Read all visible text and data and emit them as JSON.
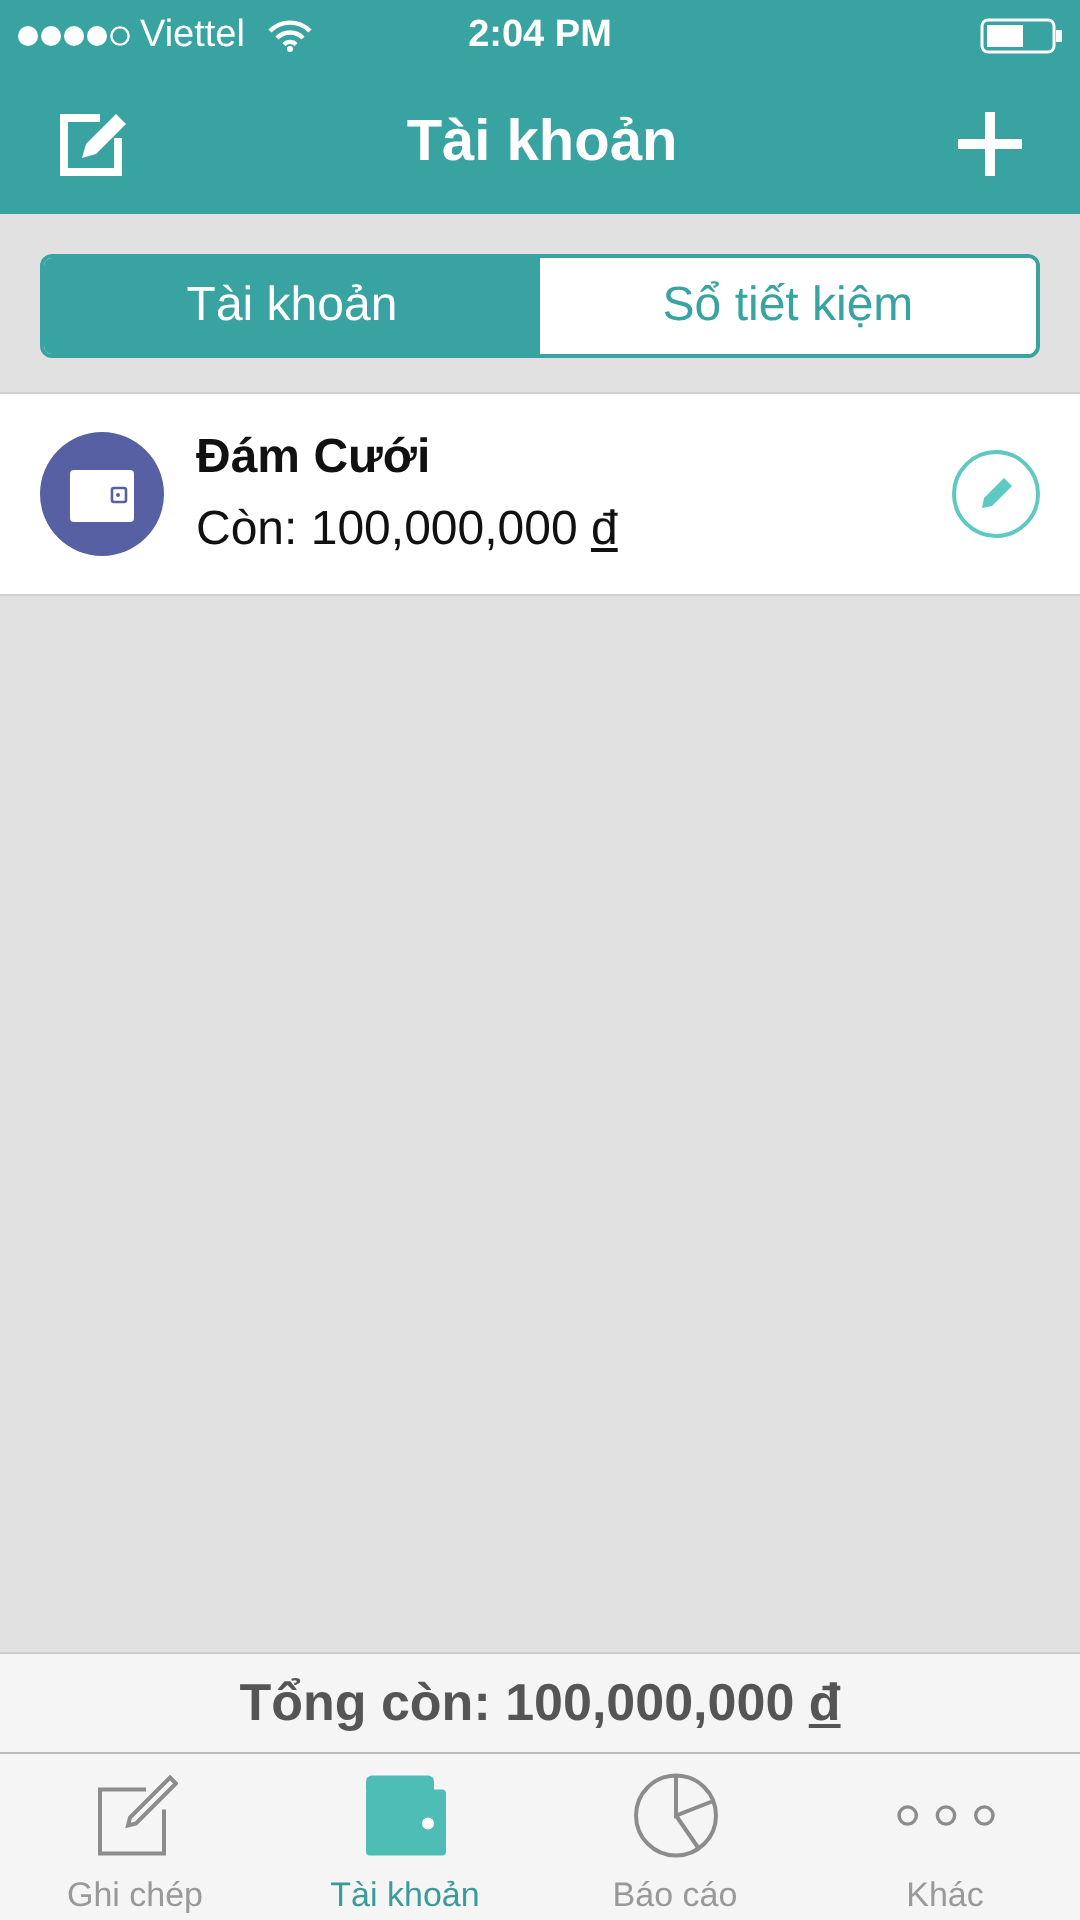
{
  "status_bar": {
    "carrier": "Viettel",
    "time": "2:04 PM"
  },
  "nav_bar": {
    "title": "Tài khoản"
  },
  "segments": [
    {
      "label": "Tài khoản",
      "selected": true
    },
    {
      "label": "Sổ tiết kiệm",
      "selected": false
    }
  ],
  "accounts": [
    {
      "name": "Đám Cưới",
      "balance": "Còn: 100,000,000",
      "currency": "đ"
    }
  ],
  "total": {
    "text": "Tổng còn: 100,000,000",
    "currency": "đ"
  },
  "tab_bar": [
    {
      "label": "Ghi chép",
      "kind": "note",
      "selected": false
    },
    {
      "label": "Tài khoản",
      "kind": "wallet",
      "selected": true
    },
    {
      "label": "Báo cáo",
      "kind": "chart",
      "selected": false
    },
    {
      "label": "Khác",
      "kind": "more",
      "selected": false
    }
  ]
}
